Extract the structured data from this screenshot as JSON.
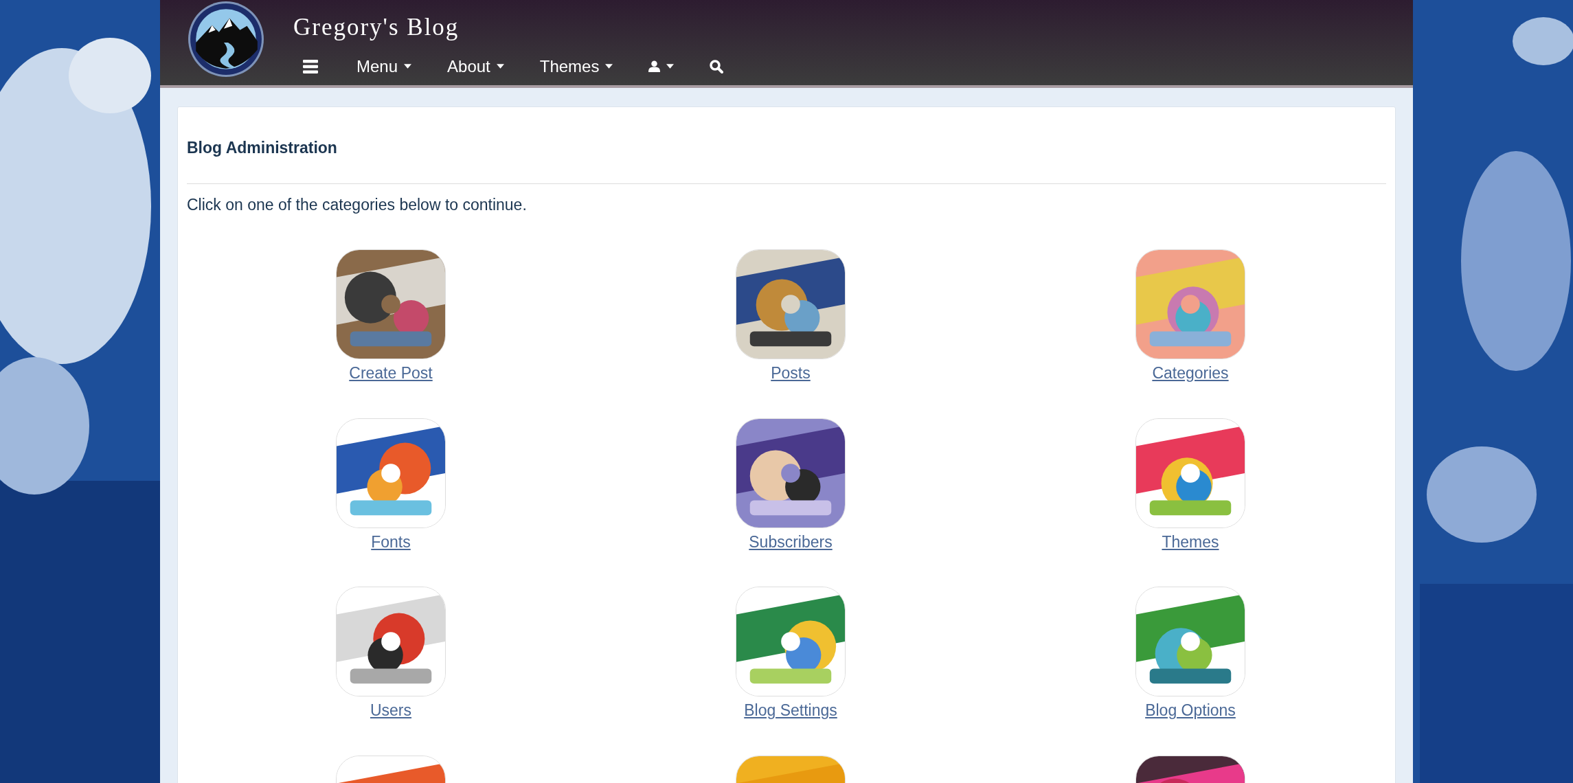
{
  "header": {
    "title": "Gregory's Blog",
    "nav": [
      {
        "kind": "menu-icon"
      },
      {
        "kind": "dropdown",
        "label": "Menu"
      },
      {
        "kind": "dropdown",
        "label": "About"
      },
      {
        "kind": "dropdown",
        "label": "Themes"
      },
      {
        "kind": "user"
      },
      {
        "kind": "search"
      }
    ]
  },
  "panel": {
    "title": "Blog Administration",
    "intro": "Click on one of the categories below to continue.",
    "tiles": [
      {
        "kind": "tile",
        "label": "Create Post"
      },
      {
        "kind": "tile",
        "label": "Posts"
      },
      {
        "kind": "tile",
        "label": "Categories"
      },
      {
        "kind": "tile",
        "label": "Fonts"
      },
      {
        "kind": "tile",
        "label": "Subscribers"
      },
      {
        "kind": "tile",
        "label": "Themes"
      },
      {
        "kind": "tile",
        "label": "Users"
      },
      {
        "kind": "tile",
        "label": "Blog Settings"
      },
      {
        "kind": "tile",
        "label": "Blog Options"
      },
      {
        "kind": "partial"
      },
      {
        "kind": "partial"
      },
      {
        "kind": "partial"
      }
    ]
  }
}
